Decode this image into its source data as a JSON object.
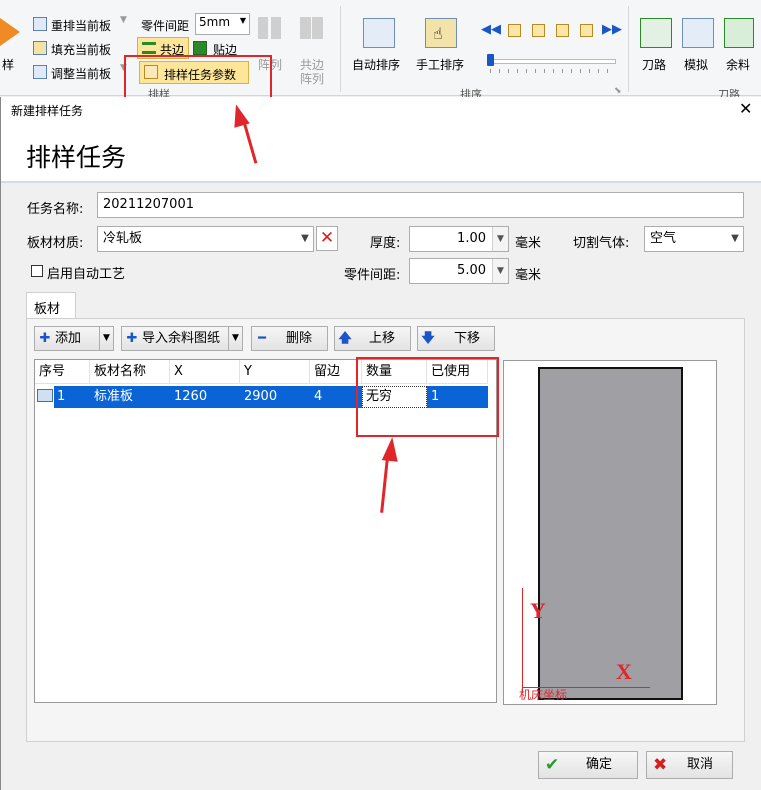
{
  "ribbon": {
    "left_cut_label": "样",
    "rearrange_label": "重排当前板",
    "fill_label": "填充当前板",
    "adjust_label": "调整当前板",
    "part_spacing_label": "零件间距",
    "part_spacing_value": "5mm",
    "common_edge_label": "共边",
    "stick_edge_label": "贴边",
    "task_params_label": "排样任务参数",
    "array_label": "阵列",
    "common_array_label_1": "共边",
    "common_array_label_2": "阵列",
    "group_nest_label": "排样",
    "auto_nest_label": "自动排序",
    "manual_nest_label": "手工排序",
    "group_sort_label": "排序",
    "toolpath_label": "刀路",
    "simulate_label": "模拟",
    "remnant_label": "余料",
    "group_toolpath_label": "刀路"
  },
  "dialog": {
    "window_title": "新建排样任务",
    "heading": "排样任务",
    "task_name_label": "任务名称:",
    "task_name_value": "20211207001",
    "material_label": "板材材质:",
    "material_value": "冷轧板",
    "thickness_label": "厚度:",
    "thickness_value": "1.00",
    "thickness_unit": "毫米",
    "gas_label": "切割气体:",
    "gas_value": "空气",
    "auto_process_label": "启用自动工艺",
    "spacing_label": "零件间距:",
    "spacing_value": "5.00",
    "spacing_unit": "毫米",
    "tab_sheet": "板材",
    "add_button": "添加",
    "import_button": "导入余料图纸",
    "delete_button": "删除",
    "up_button": "上移",
    "down_button": "下移",
    "columns": [
      "序号",
      "板材名称",
      "X",
      "Y",
      "留边",
      "数量",
      "已使用"
    ],
    "rows": [
      [
        "1",
        "标准板",
        "1260",
        "2900",
        "4",
        "无穷",
        "1"
      ]
    ],
    "preview_y_label": "Y",
    "preview_x_label": "X",
    "preview_coord_label": "机床坐标",
    "ok_button": "确定",
    "cancel_button": "取消"
  },
  "colors": {
    "selection": "#0a64d6",
    "annotation_red": "#e0262a",
    "sheet_fill": "#a0a0a4",
    "highlight_yellow": "#fde69a"
  }
}
